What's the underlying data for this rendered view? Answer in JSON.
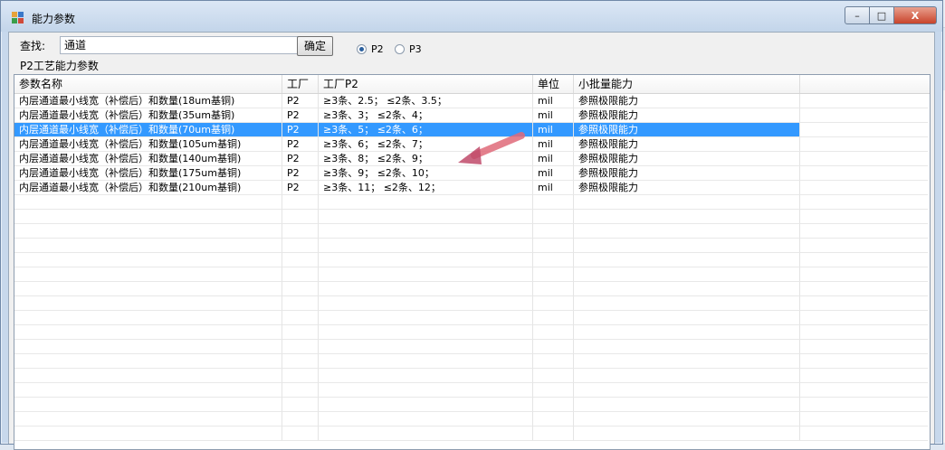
{
  "window": {
    "title": "能力参数",
    "controls": {
      "minimize": "–",
      "maximize": "□",
      "close": "X"
    }
  },
  "search": {
    "label": "查找:",
    "value": "通道",
    "button": "确定"
  },
  "radios": [
    {
      "label": "P2",
      "selected": true
    },
    {
      "label": "P3",
      "selected": false
    }
  ],
  "group_label": "P2工艺能力参数",
  "grid": {
    "columns": [
      "参数名称",
      "工厂",
      "工厂P2",
      "单位",
      "小批量能力",
      ""
    ],
    "rows": [
      [
        "内层通道最小线宽（补偿后）和数量(18um基铜)",
        "P2",
        "≥3条、2.5； ≤2条、3.5；",
        "mil",
        "参照极限能力"
      ],
      [
        "内层通道最小线宽（补偿后）和数量(35um基铜)",
        "P2",
        "≥3条、3； ≤2条、4；",
        "mil",
        "参照极限能力"
      ],
      [
        "内层通道最小线宽（补偿后）和数量(70um基铜)",
        "P2",
        "≥3条、5； ≤2条、6；",
        "mil",
        "参照极限能力"
      ],
      [
        "内层通道最小线宽（补偿后）和数量(105um基铜)",
        "P2",
        "≥3条、6； ≤2条、7；",
        "mil",
        "参照极限能力"
      ],
      [
        "内层通道最小线宽（补偿后）和数量(140um基铜)",
        "P2",
        "≥3条、8； ≤2条、9；",
        "mil",
        "参照极限能力"
      ],
      [
        "内层通道最小线宽（补偿后）和数量(175um基铜)",
        "P2",
        "≥3条、9； ≤2条、10；",
        "mil",
        "参照极限能力"
      ],
      [
        "内层通道最小线宽（补偿后）和数量(210um基铜)",
        "P2",
        "≥3条、11； ≤2条、12；",
        "mil",
        "参照极限能力"
      ]
    ],
    "selected_row": 2
  },
  "colors": {
    "selection": "#3399ff",
    "annotation_arrow": "#e06a7a"
  },
  "icons": [
    "app-icon",
    "radio-selected-icon",
    "radio-unselected-icon",
    "annotation-arrow-icon"
  ]
}
